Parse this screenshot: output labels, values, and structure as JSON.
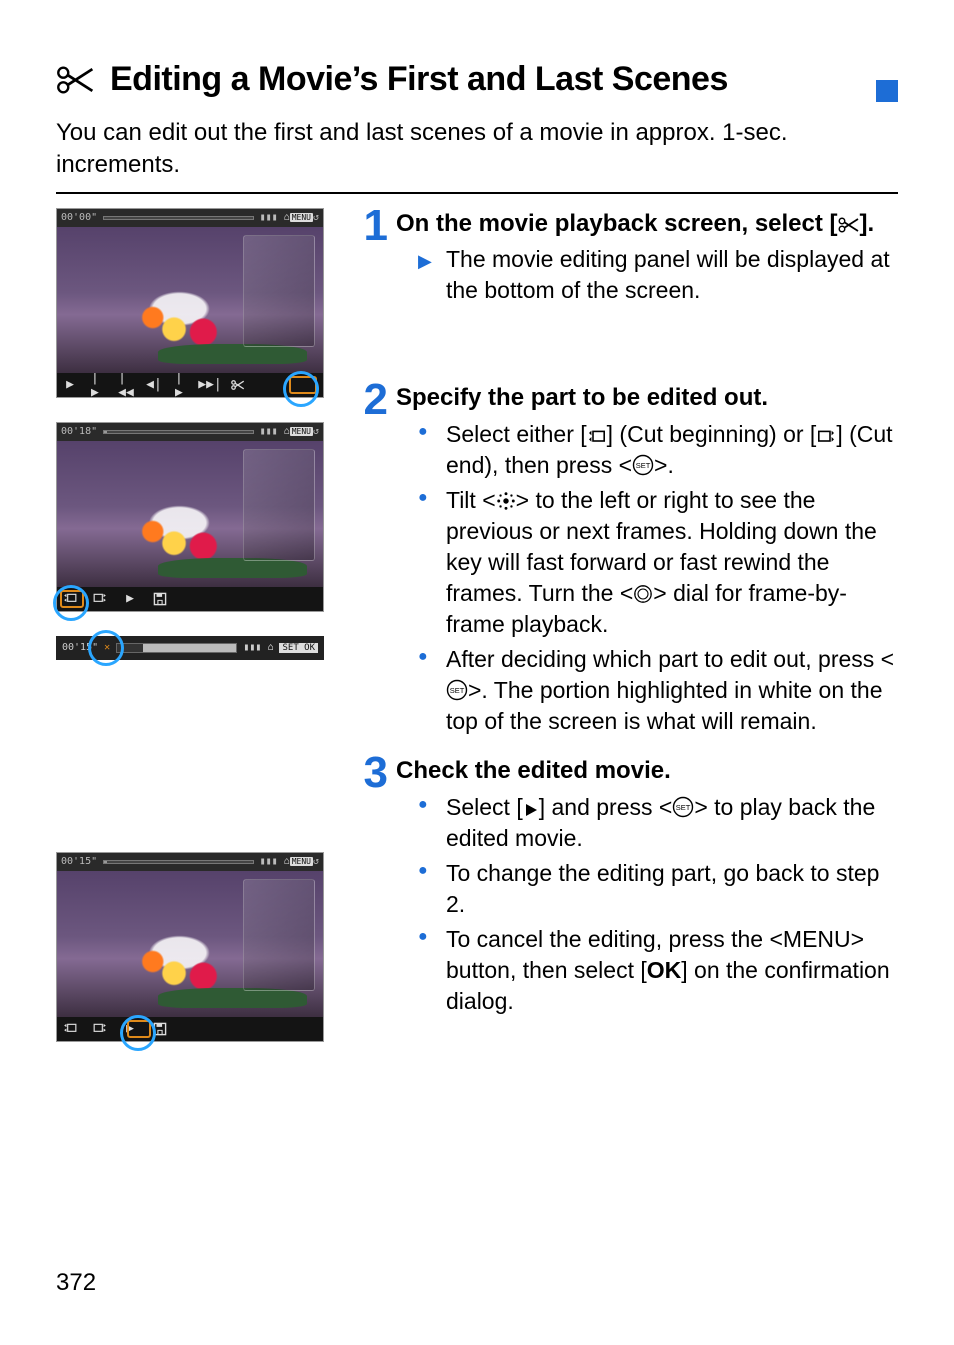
{
  "heading": "Editing a Movie’s First and Last Scenes",
  "intro": "You can edit out the first and last scenes of a movie in approx. 1-sec. increments.",
  "page_number": "372",
  "thumbs": {
    "a": {
      "time": "00'00\"",
      "menu": "MENU"
    },
    "b": {
      "time": "00'18\"",
      "menu": "MENU"
    },
    "c": {
      "time": "00'15\"",
      "menu": "MENU"
    },
    "strip": {
      "time": "00'15\"",
      "setok": "SET OK"
    }
  },
  "steps": [
    {
      "num": "1",
      "title_a": "On the movie playback screen, select [",
      "title_b": "].",
      "lead_tri": "The movie editing panel will be displayed at the bottom of the screen."
    },
    {
      "num": "2",
      "title": "Specify the part to be edited out.",
      "b1_a": "Select either [",
      "b1_b": "] (Cut beginning) or [",
      "b1_c": "] (Cut end), then press <",
      "b1_d": ">.",
      "b2_a": "Tilt <",
      "b2_b": "> to the left or right to see the previous or next frames. Holding down the key will fast forward or fast rewind the frames. Turn the <",
      "b2_c": "> dial for frame-by-frame playback.",
      "b3_a": "After deciding which part to edit out, press <",
      "b3_b": ">. The portion highlighted in white on the top of the screen is what will remain."
    },
    {
      "num": "3",
      "title": "Check the edited movie.",
      "b1_a": "Select [",
      "b1_b": "] and press <",
      "b1_c": "> to play back the edited movie.",
      "b2": "To change the editing part, go back to step 2.",
      "b3_a": "To cancel the editing, press the <",
      "b3_b": "> button, then select [",
      "b3_c": "OK",
      "b3_d": "] on the confirmation dialog.",
      "menu_word": "MENU"
    }
  ]
}
